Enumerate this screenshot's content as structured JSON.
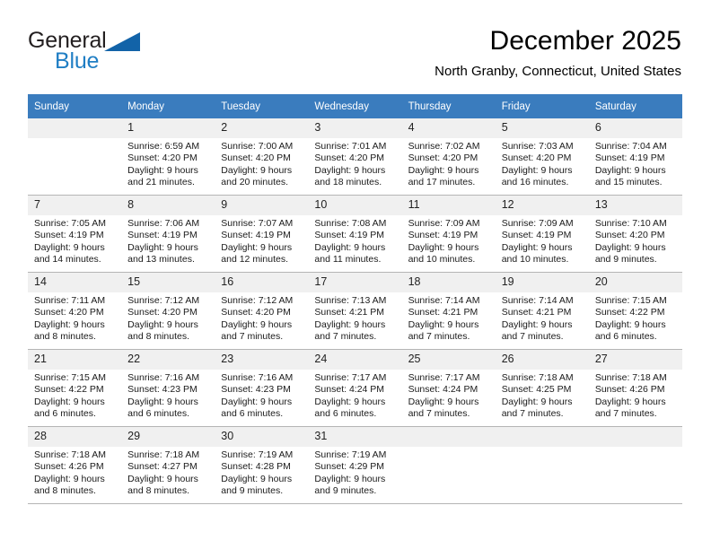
{
  "brand": {
    "name_primary": "General",
    "name_secondary": "Blue",
    "triangle_color": "#1263a8",
    "secondary_color": "#1f7ec4"
  },
  "header": {
    "title": "December 2025",
    "subtitle": "North Granby, Connecticut, United States"
  },
  "theme": {
    "header_row_bg": "#3a7cbe",
    "header_row_text": "#ffffff",
    "day_number_bg": "#f0f0f0",
    "grid_line": "#b5b5b5"
  },
  "weekday_headers": [
    "Sunday",
    "Monday",
    "Tuesday",
    "Wednesday",
    "Thursday",
    "Friday",
    "Saturday"
  ],
  "labels": {
    "sunrise_prefix": "Sunrise:",
    "sunset_prefix": "Sunset:",
    "daylight_prefix": "Daylight:"
  },
  "weeks": [
    [
      {
        "day": "",
        "empty": true,
        "line1": "",
        "line2": "",
        "line3": "",
        "line4": ""
      },
      {
        "day": "1",
        "empty": false,
        "line1": "Sunrise: 6:59 AM",
        "line2": "Sunset: 4:20 PM",
        "line3": "Daylight: 9 hours",
        "line4": "and 21 minutes."
      },
      {
        "day": "2",
        "empty": false,
        "line1": "Sunrise: 7:00 AM",
        "line2": "Sunset: 4:20 PM",
        "line3": "Daylight: 9 hours",
        "line4": "and 20 minutes."
      },
      {
        "day": "3",
        "empty": false,
        "line1": "Sunrise: 7:01 AM",
        "line2": "Sunset: 4:20 PM",
        "line3": "Daylight: 9 hours",
        "line4": "and 18 minutes."
      },
      {
        "day": "4",
        "empty": false,
        "line1": "Sunrise: 7:02 AM",
        "line2": "Sunset: 4:20 PM",
        "line3": "Daylight: 9 hours",
        "line4": "and 17 minutes."
      },
      {
        "day": "5",
        "empty": false,
        "line1": "Sunrise: 7:03 AM",
        "line2": "Sunset: 4:20 PM",
        "line3": "Daylight: 9 hours",
        "line4": "and 16 minutes."
      },
      {
        "day": "6",
        "empty": false,
        "line1": "Sunrise: 7:04 AM",
        "line2": "Sunset: 4:19 PM",
        "line3": "Daylight: 9 hours",
        "line4": "and 15 minutes."
      }
    ],
    [
      {
        "day": "7",
        "empty": false,
        "line1": "Sunrise: 7:05 AM",
        "line2": "Sunset: 4:19 PM",
        "line3": "Daylight: 9 hours",
        "line4": "and 14 minutes."
      },
      {
        "day": "8",
        "empty": false,
        "line1": "Sunrise: 7:06 AM",
        "line2": "Sunset: 4:19 PM",
        "line3": "Daylight: 9 hours",
        "line4": "and 13 minutes."
      },
      {
        "day": "9",
        "empty": false,
        "line1": "Sunrise: 7:07 AM",
        "line2": "Sunset: 4:19 PM",
        "line3": "Daylight: 9 hours",
        "line4": "and 12 minutes."
      },
      {
        "day": "10",
        "empty": false,
        "line1": "Sunrise: 7:08 AM",
        "line2": "Sunset: 4:19 PM",
        "line3": "Daylight: 9 hours",
        "line4": "and 11 minutes."
      },
      {
        "day": "11",
        "empty": false,
        "line1": "Sunrise: 7:09 AM",
        "line2": "Sunset: 4:19 PM",
        "line3": "Daylight: 9 hours",
        "line4": "and 10 minutes."
      },
      {
        "day": "12",
        "empty": false,
        "line1": "Sunrise: 7:09 AM",
        "line2": "Sunset: 4:19 PM",
        "line3": "Daylight: 9 hours",
        "line4": "and 10 minutes."
      },
      {
        "day": "13",
        "empty": false,
        "line1": "Sunrise: 7:10 AM",
        "line2": "Sunset: 4:20 PM",
        "line3": "Daylight: 9 hours",
        "line4": "and 9 minutes."
      }
    ],
    [
      {
        "day": "14",
        "empty": false,
        "line1": "Sunrise: 7:11 AM",
        "line2": "Sunset: 4:20 PM",
        "line3": "Daylight: 9 hours",
        "line4": "and 8 minutes."
      },
      {
        "day": "15",
        "empty": false,
        "line1": "Sunrise: 7:12 AM",
        "line2": "Sunset: 4:20 PM",
        "line3": "Daylight: 9 hours",
        "line4": "and 8 minutes."
      },
      {
        "day": "16",
        "empty": false,
        "line1": "Sunrise: 7:12 AM",
        "line2": "Sunset: 4:20 PM",
        "line3": "Daylight: 9 hours",
        "line4": "and 7 minutes."
      },
      {
        "day": "17",
        "empty": false,
        "line1": "Sunrise: 7:13 AM",
        "line2": "Sunset: 4:21 PM",
        "line3": "Daylight: 9 hours",
        "line4": "and 7 minutes."
      },
      {
        "day": "18",
        "empty": false,
        "line1": "Sunrise: 7:14 AM",
        "line2": "Sunset: 4:21 PM",
        "line3": "Daylight: 9 hours",
        "line4": "and 7 minutes."
      },
      {
        "day": "19",
        "empty": false,
        "line1": "Sunrise: 7:14 AM",
        "line2": "Sunset: 4:21 PM",
        "line3": "Daylight: 9 hours",
        "line4": "and 7 minutes."
      },
      {
        "day": "20",
        "empty": false,
        "line1": "Sunrise: 7:15 AM",
        "line2": "Sunset: 4:22 PM",
        "line3": "Daylight: 9 hours",
        "line4": "and 6 minutes."
      }
    ],
    [
      {
        "day": "21",
        "empty": false,
        "line1": "Sunrise: 7:15 AM",
        "line2": "Sunset: 4:22 PM",
        "line3": "Daylight: 9 hours",
        "line4": "and 6 minutes."
      },
      {
        "day": "22",
        "empty": false,
        "line1": "Sunrise: 7:16 AM",
        "line2": "Sunset: 4:23 PM",
        "line3": "Daylight: 9 hours",
        "line4": "and 6 minutes."
      },
      {
        "day": "23",
        "empty": false,
        "line1": "Sunrise: 7:16 AM",
        "line2": "Sunset: 4:23 PM",
        "line3": "Daylight: 9 hours",
        "line4": "and 6 minutes."
      },
      {
        "day": "24",
        "empty": false,
        "line1": "Sunrise: 7:17 AM",
        "line2": "Sunset: 4:24 PM",
        "line3": "Daylight: 9 hours",
        "line4": "and 6 minutes."
      },
      {
        "day": "25",
        "empty": false,
        "line1": "Sunrise: 7:17 AM",
        "line2": "Sunset: 4:24 PM",
        "line3": "Daylight: 9 hours",
        "line4": "and 7 minutes."
      },
      {
        "day": "26",
        "empty": false,
        "line1": "Sunrise: 7:18 AM",
        "line2": "Sunset: 4:25 PM",
        "line3": "Daylight: 9 hours",
        "line4": "and 7 minutes."
      },
      {
        "day": "27",
        "empty": false,
        "line1": "Sunrise: 7:18 AM",
        "line2": "Sunset: 4:26 PM",
        "line3": "Daylight: 9 hours",
        "line4": "and 7 minutes."
      }
    ],
    [
      {
        "day": "28",
        "empty": false,
        "line1": "Sunrise: 7:18 AM",
        "line2": "Sunset: 4:26 PM",
        "line3": "Daylight: 9 hours",
        "line4": "and 8 minutes."
      },
      {
        "day": "29",
        "empty": false,
        "line1": "Sunrise: 7:18 AM",
        "line2": "Sunset: 4:27 PM",
        "line3": "Daylight: 9 hours",
        "line4": "and 8 minutes."
      },
      {
        "day": "30",
        "empty": false,
        "line1": "Sunrise: 7:19 AM",
        "line2": "Sunset: 4:28 PM",
        "line3": "Daylight: 9 hours",
        "line4": "and 9 minutes."
      },
      {
        "day": "31",
        "empty": false,
        "line1": "Sunrise: 7:19 AM",
        "line2": "Sunset: 4:29 PM",
        "line3": "Daylight: 9 hours",
        "line4": "and 9 minutes."
      },
      {
        "day": "",
        "empty": true,
        "line1": "",
        "line2": "",
        "line3": "",
        "line4": ""
      },
      {
        "day": "",
        "empty": true,
        "line1": "",
        "line2": "",
        "line3": "",
        "line4": ""
      },
      {
        "day": "",
        "empty": true,
        "line1": "",
        "line2": "",
        "line3": "",
        "line4": ""
      }
    ]
  ]
}
